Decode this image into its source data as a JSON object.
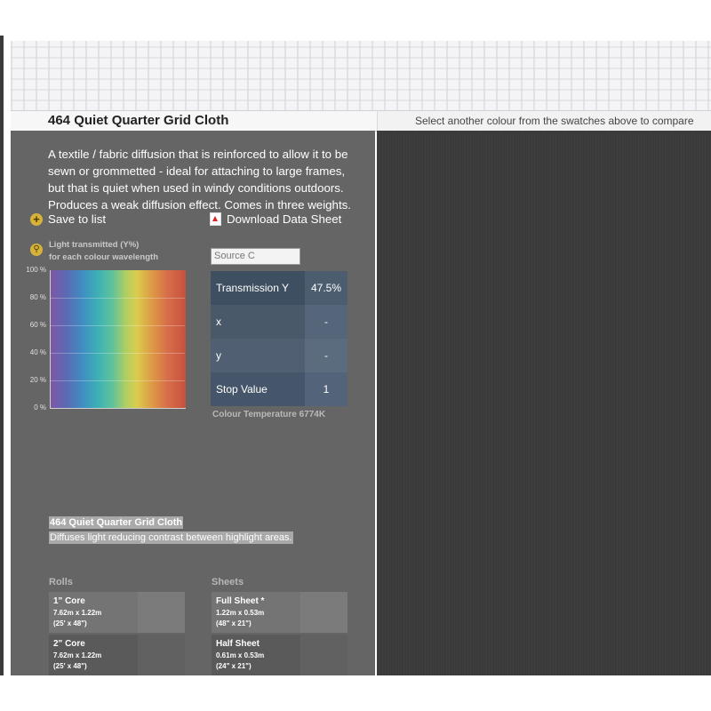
{
  "product": {
    "title": "464 Quiet Quarter Grid Cloth",
    "compare_hint": "Select another colour from the swatches above to compare",
    "description": "A textile / fabric diffusion that is reinforced to allow it to be sewn or grommetted - ideal for attaching to large frames, but that is quiet when used in windy conditions outdoors. Produces a weak diffusion effect. Comes in three weights.",
    "save_label": "Save to list",
    "download_label": "Download Data Sheet"
  },
  "chart_data": {
    "type": "area",
    "title": "Light transmitted (Y%)",
    "subtitle": "for each colour wavelength",
    "yticks": [
      "100 %",
      "80 %",
      "60 %",
      "40 %",
      "20 %",
      "0 %"
    ],
    "ylim": [
      0,
      100
    ],
    "values": [
      100
    ]
  },
  "measurements": {
    "source": "Source C",
    "rows": [
      {
        "label": "Transmission Y",
        "value": "47.5%"
      },
      {
        "label": "x",
        "value": "-"
      },
      {
        "label": "y",
        "value": "-"
      },
      {
        "label": "Stop Value",
        "value": "1"
      }
    ],
    "colour_temperature": "Colour Temperature 6774K"
  },
  "selection": {
    "name": "464 Quiet Quarter Grid Cloth",
    "summary": "Diffuses light reducing contrast between highlight areas."
  },
  "rolls": {
    "heading": "Rolls",
    "items": [
      {
        "name": "1\" Core",
        "dim1": "7.62m x 1.22m",
        "dim2": "(25' x 48\")"
      },
      {
        "name": "2\" Core",
        "dim1": "7.62m x 1.22m",
        "dim2": "(25' x 48\")"
      }
    ]
  },
  "sheets": {
    "heading": "Sheets",
    "items": [
      {
        "name": "Full Sheet *",
        "dim1": "1.22m x 0.53m",
        "dim2": "(48\" x 21\")"
      },
      {
        "name": "Half Sheet",
        "dim1": "0.61m x 0.53m",
        "dim2": "(24\" x 21\")"
      }
    ]
  },
  "colors": {
    "panel": "#656565",
    "compare_panel": "#3a3a3a",
    "table": "#46566a",
    "accent": "#d6b23a"
  },
  "icons": {
    "save": "plus-circle-icon",
    "download": "pdf-icon",
    "zoom": "magnifier-icon"
  }
}
